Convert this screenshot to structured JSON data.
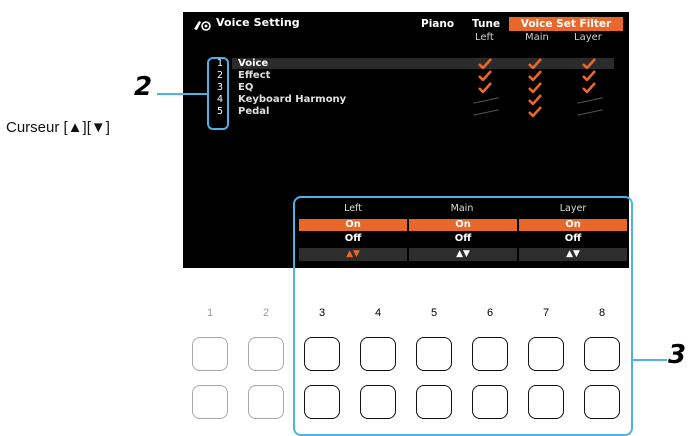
{
  "screen": {
    "title": "Voice Setting",
    "tabs": [
      {
        "label": "Piano",
        "active": false
      },
      {
        "label": "Tune",
        "active": false
      },
      {
        "label": "Voice Set Filter",
        "active": true
      }
    ],
    "columns": [
      "Left",
      "Main",
      "Layer"
    ],
    "rows": [
      {
        "num": "1",
        "label": "Voice",
        "left": true,
        "main": true,
        "layer": true
      },
      {
        "num": "2",
        "label": "Effect",
        "left": true,
        "main": true,
        "layer": true
      },
      {
        "num": "3",
        "label": "EQ",
        "left": true,
        "main": true,
        "layer": true
      },
      {
        "num": "4",
        "label": "Keyboard Harmony",
        "left": false,
        "main": true,
        "layer": false
      },
      {
        "num": "5",
        "label": "Pedal",
        "left": false,
        "main": true,
        "layer": false
      }
    ]
  },
  "subpanel": {
    "columns": [
      {
        "head": "Left",
        "on": "On",
        "off": "Off",
        "arrows": "▲▼",
        "arrows_active": true
      },
      {
        "head": "Main",
        "on": "On",
        "off": "Off",
        "arrows": "▲▼",
        "arrows_active": false
      },
      {
        "head": "Layer",
        "on": "On",
        "off": "Off",
        "arrows": "▲▼",
        "arrows_active": false
      }
    ]
  },
  "annotations": {
    "callout_2": "2",
    "callout_3": "3",
    "cursor_label": "Curseur [▲][▼]"
  },
  "buttons": {
    "numbers": [
      "1",
      "2",
      "3",
      "4",
      "5",
      "6",
      "7",
      "8"
    ]
  },
  "colors": {
    "accent": "#e8672b",
    "frame": "#4db3e6",
    "screen_bg": "#000000"
  }
}
